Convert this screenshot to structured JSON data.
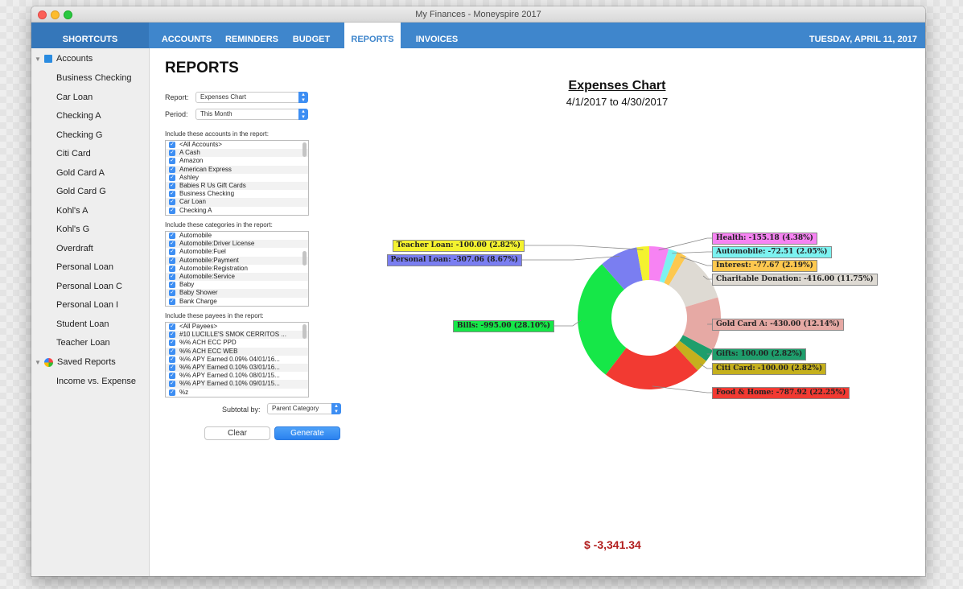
{
  "window": {
    "title": "My Finances - Moneyspire 2017"
  },
  "nav": {
    "shortcuts": "SHORTCUTS",
    "tabs": [
      "ACCOUNTS",
      "REMINDERS",
      "BUDGET",
      "REPORTS",
      "INVOICES"
    ],
    "active_tab": "REPORTS",
    "date": "TUESDAY, APRIL 11, 2017"
  },
  "sidebar": {
    "accounts_header": "Accounts",
    "accounts": [
      "Business Checking",
      "Car Loan",
      "Checking A",
      "Checking G",
      "Citi Card",
      "Gold Card A",
      "Gold Card G",
      "Kohl's A",
      "Kohl's G",
      "Overdraft",
      "Personal Loan",
      "Personal Loan C",
      "Personal Loan I",
      "Student Loan",
      "Teacher Loan"
    ],
    "reports_header": "Saved Reports",
    "reports": [
      "Income vs. Expense"
    ]
  },
  "reports": {
    "title": "REPORTS",
    "report_label": "Report:",
    "report_value": "Expenses Chart",
    "period_label": "Period:",
    "period_value": "This Month",
    "accounts_label": "Include these accounts in the report:",
    "accounts": [
      "<All Accounts>",
      "A Cash",
      "Amazon",
      "American Express",
      "Ashley",
      "Babies R Us Gift Cards",
      "Business Checking",
      "Car Loan",
      "Checking A"
    ],
    "categories_label": "Include these categories in the report:",
    "categories": [
      "Automobile",
      "Automobile:Driver License",
      "Automobile:Fuel",
      "Automobile:Payment",
      "Automobile:Registration",
      "Automobile:Service",
      "Baby",
      "Baby Shower",
      "Bank Charge"
    ],
    "payees_label": "Include these payees in the report:",
    "payees": [
      "<All Payees>",
      "#10 LUCILLE'S SMOK CERRITOS ...",
      "%% ACH ECC PPD",
      "%% ACH ECC WEB",
      "%% APY Earned 0.09% 04/01/16...",
      "%% APY Earned 0.10% 03/01/16...",
      "%% APY Earned 0.10% 08/01/15...",
      "%% APY Earned 0.10% 09/01/15...",
      "%z"
    ],
    "subtotal_label": "Subtotal by:",
    "subtotal_value": "Parent Category",
    "clear_label": "Clear",
    "generate_label": "Generate"
  },
  "chart_data": {
    "type": "pie",
    "title": "Expenses Chart",
    "subtitle": "4/1/2017 to 4/30/2017",
    "total": "$ -3,341.34",
    "slices": [
      {
        "name": "Health",
        "value": -155.18,
        "percent": 4.38,
        "label": "Health: -155.18 (4.38%)",
        "color": "#f783f3"
      },
      {
        "name": "Automobile",
        "value": -72.51,
        "percent": 2.05,
        "label": "Automobile: -72.51 (2.05%)",
        "color": "#7cf2f0"
      },
      {
        "name": "Interest",
        "value": -77.67,
        "percent": 2.19,
        "label": "Interest: -77.67 (2.19%)",
        "color": "#fdc84f"
      },
      {
        "name": "Charitable Donation",
        "value": -416.0,
        "percent": 11.75,
        "label": "Charitable Donation: -416.00 (11.75%)",
        "color": "#dedad3"
      },
      {
        "name": "Gold Card A",
        "value": -430.0,
        "percent": 12.14,
        "label": "Gold Card A: -430.00 (12.14%)",
        "color": "#e6a9a4"
      },
      {
        "name": "Gifts",
        "value": 100.0,
        "percent": 2.82,
        "label": "Gifts: 100.00 (2.82%)",
        "color": "#1e9e6c"
      },
      {
        "name": "Citi Card",
        "value": -100.0,
        "percent": 2.82,
        "label": "Citi Card: -100.00 (2.82%)",
        "color": "#c5b01d"
      },
      {
        "name": "Food & Home",
        "value": -787.92,
        "percent": 22.25,
        "label": "Food & Home: -787.92 (22.25%)",
        "color": "#f23a32"
      },
      {
        "name": "Bills",
        "value": -995.0,
        "percent": 28.1,
        "label": "Bills: -995.00 (28.10%)",
        "color": "#16e748"
      },
      {
        "name": "Personal Loan",
        "value": -307.06,
        "percent": 8.67,
        "label": "Personal Loan: -307.06 (8.67%)",
        "color": "#7a7ef1"
      },
      {
        "name": "Teacher Loan",
        "value": -100.0,
        "percent": 2.82,
        "label": "Teacher Loan: -100.00 (2.82%)",
        "color": "#f4f22f"
      }
    ]
  }
}
